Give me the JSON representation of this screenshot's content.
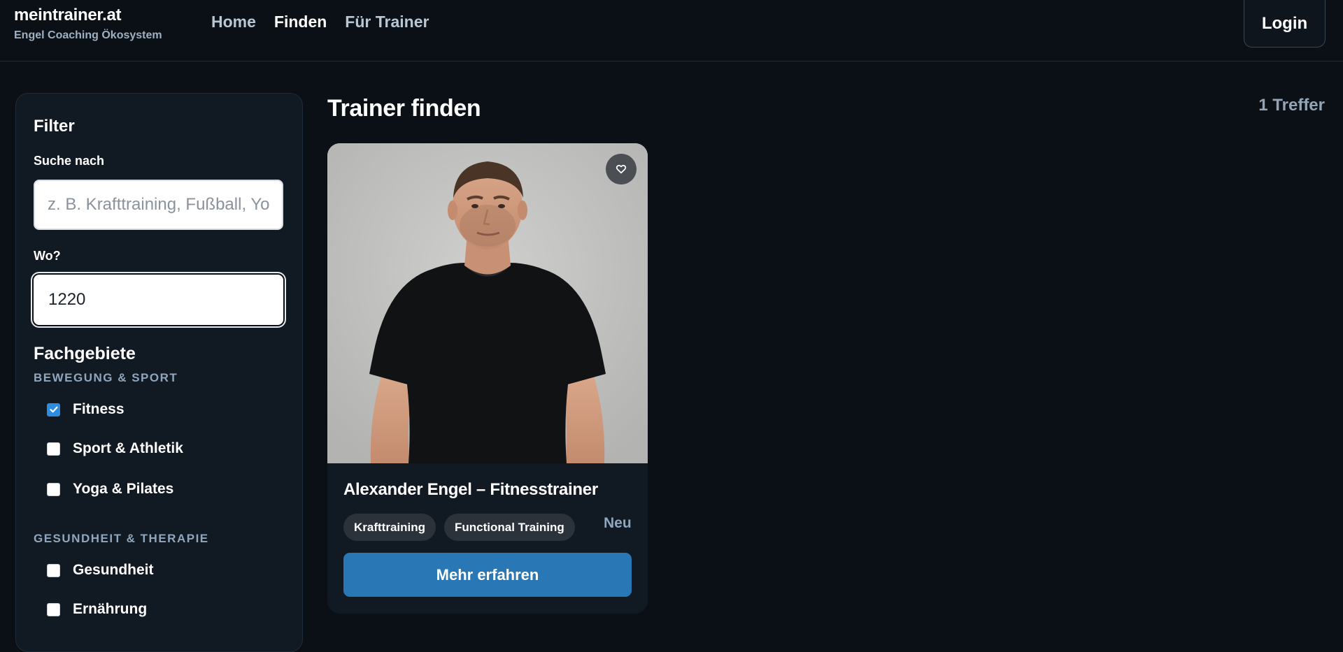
{
  "header": {
    "brand_title": "meintrainer.at",
    "brand_subtitle": "Engel Coaching Ökosystem",
    "nav": [
      {
        "label": "Home",
        "active": false
      },
      {
        "label": "Finden",
        "active": true
      },
      {
        "label": "Für Trainer",
        "active": false
      }
    ],
    "login_label": "Login"
  },
  "sidebar": {
    "title": "Filter",
    "search_label": "Suche nach",
    "search_placeholder": "z. B. Krafttraining, Fußball, Yoga",
    "search_value": "",
    "location_label": "Wo?",
    "location_value": "1220",
    "section_title": "Fachgebiete",
    "groups": [
      {
        "title": "BEWEGUNG & SPORT",
        "items": [
          {
            "label": "Fitness",
            "checked": true
          },
          {
            "label": "Sport & Athletik",
            "checked": false
          },
          {
            "label": "Yoga & Pilates",
            "checked": false
          }
        ]
      },
      {
        "title": "GESUNDHEIT & THERAPIE",
        "items": [
          {
            "label": "Gesundheit",
            "checked": false
          },
          {
            "label": "Ernährung",
            "checked": false
          }
        ]
      }
    ]
  },
  "main": {
    "title": "Trainer finden",
    "result_count": "1 Treffer",
    "cards": [
      {
        "name": "Alexander Engel – Fitnesstrainer",
        "tags": [
          "Krafttraining",
          "Functional Training"
        ],
        "badge": "Neu",
        "cta_label": "Mehr erfahren"
      }
    ]
  },
  "colors": {
    "background": "#0b1017",
    "panel": "#111923",
    "accent": "#2a77b5",
    "checkbox_on": "#2f8de0",
    "muted_heading": "#8fa6bd"
  }
}
